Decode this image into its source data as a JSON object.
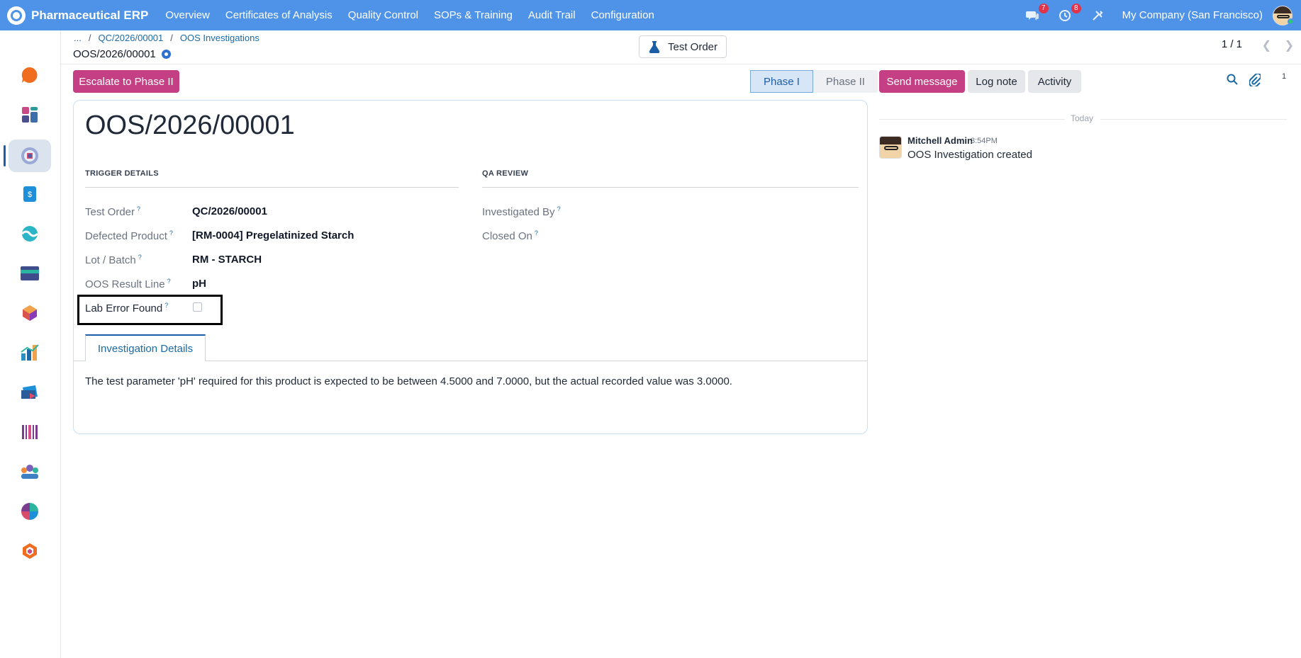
{
  "app": {
    "name": "Pharmaceutical ERP",
    "menu": [
      "Overview",
      "Certificates of Analysis",
      "Quality Control",
      "SOPs & Training",
      "Audit Trail",
      "Configuration"
    ],
    "messages_badge": "7",
    "activity_badge": "8",
    "company": "My Company (San Francisco)"
  },
  "breadcrumb": {
    "ellipsis": "...",
    "parent": "QC/2026/00001",
    "current": "OOS Investigations"
  },
  "record_title": "OOS/2026/00001",
  "smart_button": "Test Order",
  "pager": "1 / 1",
  "actions": {
    "escalate": "Escalate to Phase II",
    "stages": [
      "Phase I",
      "Phase II"
    ],
    "active_stage": "Phase I"
  },
  "chatter": {
    "send_message": "Send message",
    "log_note": "Log note",
    "activity": "Activity",
    "attachment_count": "1",
    "date_separator": "Today",
    "message": {
      "author": "Mitchell Admin",
      "time": "3:54PM",
      "body": "OOS Investigation created"
    }
  },
  "form": {
    "name": "OOS/2026/00001",
    "trigger_title": "TRIGGER DETAILS",
    "qa_title": "QA REVIEW",
    "fields": {
      "test_order": {
        "label": "Test Order",
        "value": "QC/2026/00001"
      },
      "defected_product": {
        "label": "Defected Product",
        "value": "[RM-0004] Pregelatinized Starch"
      },
      "lot_batch": {
        "label": "Lot / Batch",
        "value": "RM - STARCH"
      },
      "oos_result_line": {
        "label": "OOS Result Line",
        "value": "pH"
      },
      "lab_error_found": {
        "label": "Lab Error Found",
        "value": false
      },
      "investigated_by": {
        "label": "Investigated By",
        "value": ""
      },
      "closed_on": {
        "label": "Closed On",
        "value": ""
      }
    },
    "help_marker": "?",
    "tab": "Investigation Details",
    "details_text": "The test parameter 'pH' required for this product is expected to be between 4.5000 and 7.0000, but the actual recorded value was 3.0000."
  },
  "colors": {
    "navbar": "#4f93e8",
    "primary": "#c43f84",
    "link": "#1c6aa6",
    "badge": "#e0334c"
  }
}
